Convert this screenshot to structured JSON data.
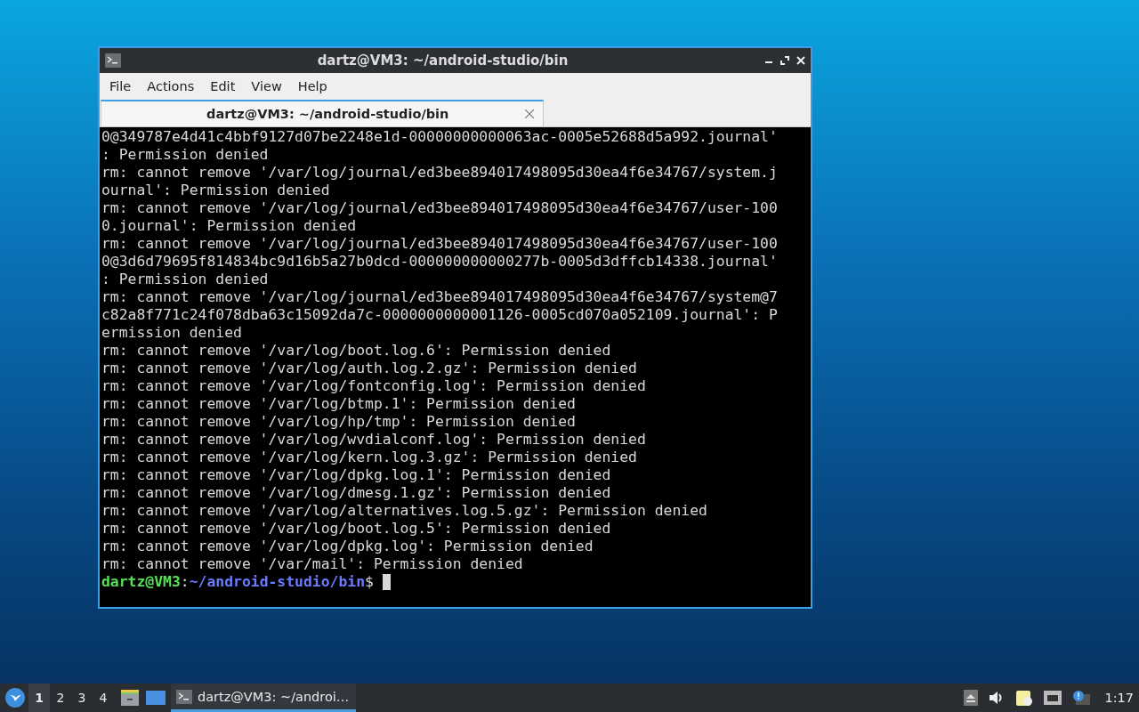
{
  "window": {
    "title": "dartz@VM3: ~/android-studio/bin"
  },
  "menu": [
    "File",
    "Actions",
    "Edit",
    "View",
    "Help"
  ],
  "tabs": [
    {
      "label": "dartz@VM3: ~/android-studio/bin",
      "selected": true
    }
  ],
  "terminal": {
    "lines": [
      "0@349787e4d41c4bbf9127d07be2248e1d-00000000000063ac-0005e52688d5a992.journal'",
      ": Permission denied",
      "rm: cannot remove '/var/log/journal/ed3bee894017498095d30ea4f6e34767/system.j",
      "ournal': Permission denied",
      "rm: cannot remove '/var/log/journal/ed3bee894017498095d30ea4f6e34767/user-100",
      "0.journal': Permission denied",
      "rm: cannot remove '/var/log/journal/ed3bee894017498095d30ea4f6e34767/user-100",
      "0@3d6d79695f814834bc9d16b5a27b0dcd-000000000000277b-0005d3dffcb14338.journal'",
      ": Permission denied",
      "rm: cannot remove '/var/log/journal/ed3bee894017498095d30ea4f6e34767/system@7",
      "c82a8f771c24f078dba63c15092da7c-0000000000001126-0005cd070a052109.journal': P",
      "ermission denied",
      "rm: cannot remove '/var/log/boot.log.6': Permission denied",
      "rm: cannot remove '/var/log/auth.log.2.gz': Permission denied",
      "rm: cannot remove '/var/log/fontconfig.log': Permission denied",
      "rm: cannot remove '/var/log/btmp.1': Permission denied",
      "rm: cannot remove '/var/log/hp/tmp': Permission denied",
      "rm: cannot remove '/var/log/wvdialconf.log': Permission denied",
      "rm: cannot remove '/var/log/kern.log.3.gz': Permission denied",
      "rm: cannot remove '/var/log/dpkg.log.1': Permission denied",
      "rm: cannot remove '/var/log/dmesg.1.gz': Permission denied",
      "rm: cannot remove '/var/log/alternatives.log.5.gz': Permission denied",
      "rm: cannot remove '/var/log/boot.log.5': Permission denied",
      "rm: cannot remove '/var/log/dpkg.log': Permission denied",
      "rm: cannot remove '/var/mail': Permission denied"
    ],
    "prompt": {
      "user_host": "dartz@VM3",
      "separator": ":",
      "path": "~/android-studio/bin",
      "symbol": "$"
    }
  },
  "taskbar": {
    "workspaces": [
      {
        "label": "1",
        "selected": true
      },
      {
        "label": "2",
        "selected": false
      },
      {
        "label": "3",
        "selected": false
      },
      {
        "label": "4",
        "selected": false
      }
    ],
    "tasks": [
      {
        "label": "dartz@VM3: ~/androi…",
        "selected": true
      }
    ],
    "clock": "1:17"
  }
}
